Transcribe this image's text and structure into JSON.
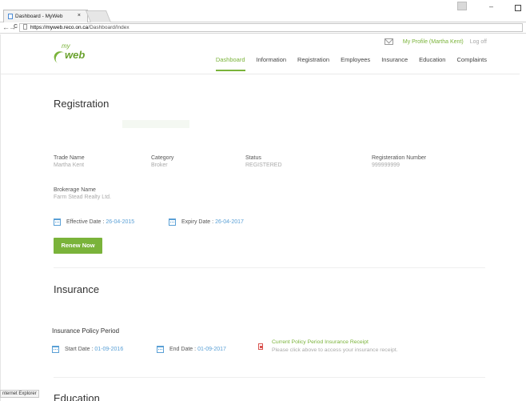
{
  "browser": {
    "tab_title": "Dashboard - MyWeb",
    "tab_close": "×",
    "url_host": "https://myweb.reco.on.ca",
    "url_path": "/Dashboard/Index",
    "back": "←",
    "forward": "→",
    "reload": "C",
    "min": "–"
  },
  "header": {
    "logo_my": "my",
    "logo_web": "web",
    "profile_link": "My Profile (Martha Kent)",
    "logoff_link": "Log off",
    "nav": [
      {
        "label": "Dashboard",
        "active": true
      },
      {
        "label": "Information"
      },
      {
        "label": "Registration"
      },
      {
        "label": "Employees"
      },
      {
        "label": "Insurance"
      },
      {
        "label": "Education"
      },
      {
        "label": "Complaints"
      }
    ]
  },
  "registration": {
    "title": "Registration",
    "trade_name_label": "Trade Name",
    "trade_name_value": "Martha Kent",
    "category_label": "Category",
    "category_value": "Broker",
    "status_label": "Status",
    "status_value": "REGISTERED",
    "reg_number_label": "Registeration Number",
    "reg_number_value": "999999999",
    "brokerage_label": "Brokerage Name",
    "brokerage_value": "Farm Stead Realty Ltd.",
    "effective_label": "Effective Date :",
    "effective_value": "26-04-2015",
    "expiry_label": "Expiry Date :",
    "expiry_value": "26-04-2017",
    "renew_button": "Renew Now"
  },
  "insurance": {
    "title": "Insurance",
    "policy_period_label": "Insurance Policy Period",
    "start_label": "Start Date :",
    "start_value": "01-09-2016",
    "end_label": "End Date :",
    "end_value": "01-09-2017",
    "receipt_link": "Current Policy Period Insurance Receipt",
    "receipt_note": "Please click above to access your insurance receipt."
  },
  "education": {
    "title": "Education"
  },
  "status_bar": "nternet Explorer",
  "colors": {
    "accent_green": "#7ab33a",
    "date_blue": "#5aa0d6",
    "pdf_red": "#d9534f"
  }
}
